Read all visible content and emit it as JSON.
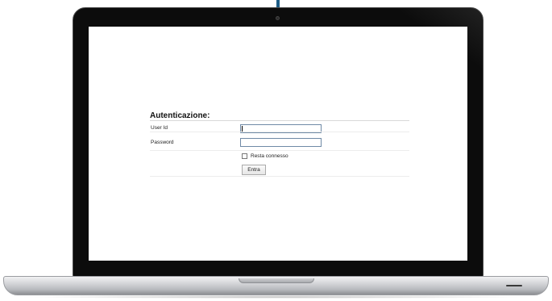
{
  "form": {
    "title": "Autenticazione:",
    "userid_label": "User Id",
    "userid_value": "",
    "password_label": "Password",
    "password_value": "",
    "remember_label": "Resta connesso",
    "remember_checked": false,
    "submit_label": "Entra"
  },
  "colors": {
    "bezel": "#0c0c0c",
    "cable": "#1d5d86",
    "input_border": "#6f8aa6",
    "screen_bg": "#ffffff"
  }
}
